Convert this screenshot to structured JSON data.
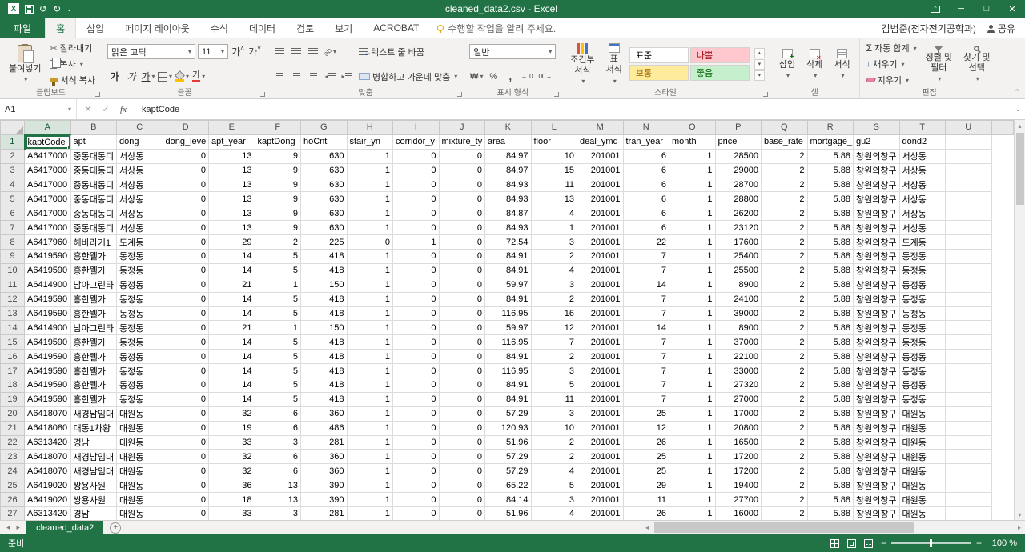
{
  "window": {
    "title": "cleaned_data2.csv - Excel"
  },
  "tabs": {
    "file": "파일",
    "items": [
      "홈",
      "삽입",
      "페이지 레이아웃",
      "수식",
      "데이터",
      "검토",
      "보기",
      "ACROBAT"
    ],
    "active": "홈",
    "tell_me": "수행할 작업을 알려 주세요.",
    "account": "김범준(전자전기공학과)",
    "share": "공유"
  },
  "ribbon": {
    "clipboard": {
      "label": "클립보드",
      "paste": "붙여넣기",
      "cut": "잘라내기",
      "copy": "복사",
      "format_painter": "서식 복사"
    },
    "font": {
      "label": "글꼴",
      "family": "맑은 고딕",
      "size": "11"
    },
    "alignment": {
      "label": "맞춤",
      "wrap": "텍스트 줄 바꿈",
      "merge": "병합하고 가운데 맞춤"
    },
    "number": {
      "label": "표시 형식",
      "format": "일반"
    },
    "styles": {
      "label": "스타일",
      "conditional_line1": "조건부",
      "conditional_line2": "서식",
      "table_line1": "표",
      "table_line2": "서식",
      "cell_styles": [
        "표준",
        "나쁨",
        "보통",
        "좋음"
      ]
    },
    "cells": {
      "label": "셀",
      "insert": "삽입",
      "delete": "삭제",
      "format": "서식"
    },
    "editing": {
      "label": "편집",
      "autosum": "자동 합계",
      "fill": "채우기",
      "clear": "지우기",
      "sort_line1": "정렬 및",
      "sort_line2": "필터",
      "find_line1": "찾기 및",
      "find_line2": "선택"
    }
  },
  "formula_bar": {
    "name_box": "A1",
    "content": "kaptCode"
  },
  "grid": {
    "selected_cell": "A1",
    "selected_col": "A",
    "selected_row": 1,
    "columns": [
      "A",
      "B",
      "C",
      "D",
      "E",
      "F",
      "G",
      "H",
      "I",
      "J",
      "K",
      "L",
      "M",
      "N",
      "O",
      "P",
      "Q",
      "R",
      "S",
      "T",
      "U"
    ],
    "col_headers": [
      "kaptCode",
      "apt",
      "dong",
      "dong_leve",
      "apt_year",
      "kaptDong",
      "hoCnt",
      "stair_yn",
      "corridor_y",
      "mixture_ty",
      "area",
      "floor",
      "deal_ymd",
      "tran_year",
      "month",
      "price",
      "base_rate",
      "mortgage_",
      "gu2",
      "dond2"
    ],
    "numeric_columns": [
      3,
      4,
      5,
      6,
      7,
      8,
      9,
      10,
      11,
      12,
      13,
      14,
      15,
      16,
      17
    ],
    "rows": [
      [
        "A6417000",
        "중동대동디",
        "서상동",
        "0",
        "13",
        "9",
        "630",
        "1",
        "0",
        "0",
        "84.97",
        "10",
        "201001",
        "6",
        "1",
        "28500",
        "2",
        "5.88",
        "창원의창구",
        "서상동"
      ],
      [
        "A6417000",
        "중동대동디",
        "서상동",
        "0",
        "13",
        "9",
        "630",
        "1",
        "0",
        "0",
        "84.97",
        "15",
        "201001",
        "6",
        "1",
        "29000",
        "2",
        "5.88",
        "창원의창구",
        "서상동"
      ],
      [
        "A6417000",
        "중동대동디",
        "서상동",
        "0",
        "13",
        "9",
        "630",
        "1",
        "0",
        "0",
        "84.93",
        "11",
        "201001",
        "6",
        "1",
        "28700",
        "2",
        "5.88",
        "창원의창구",
        "서상동"
      ],
      [
        "A6417000",
        "중동대동디",
        "서상동",
        "0",
        "13",
        "9",
        "630",
        "1",
        "0",
        "0",
        "84.93",
        "13",
        "201001",
        "6",
        "1",
        "28800",
        "2",
        "5.88",
        "창원의창구",
        "서상동"
      ],
      [
        "A6417000",
        "중동대동디",
        "서상동",
        "0",
        "13",
        "9",
        "630",
        "1",
        "0",
        "0",
        "84.87",
        "4",
        "201001",
        "6",
        "1",
        "26200",
        "2",
        "5.88",
        "창원의창구",
        "서상동"
      ],
      [
        "A6417000",
        "중동대동디",
        "서상동",
        "0",
        "13",
        "9",
        "630",
        "1",
        "0",
        "0",
        "84.93",
        "1",
        "201001",
        "6",
        "1",
        "23120",
        "2",
        "5.88",
        "창원의창구",
        "서상동"
      ],
      [
        "A6417960",
        "해바라기1",
        "도계동",
        "0",
        "29",
        "2",
        "225",
        "0",
        "1",
        "0",
        "72.54",
        "3",
        "201001",
        "22",
        "1",
        "17600",
        "2",
        "5.88",
        "창원의창구",
        "도계동"
      ],
      [
        "A6419590",
        "흥한웰가",
        "동정동",
        "0",
        "14",
        "5",
        "418",
        "1",
        "0",
        "0",
        "84.91",
        "2",
        "201001",
        "7",
        "1",
        "25400",
        "2",
        "5.88",
        "창원의창구",
        "동정동"
      ],
      [
        "A6419590",
        "흥한웰가",
        "동정동",
        "0",
        "14",
        "5",
        "418",
        "1",
        "0",
        "0",
        "84.91",
        "4",
        "201001",
        "7",
        "1",
        "25500",
        "2",
        "5.88",
        "창원의창구",
        "동정동"
      ],
      [
        "A6414900",
        "남아그린타",
        "동정동",
        "0",
        "21",
        "1",
        "150",
        "1",
        "0",
        "0",
        "59.97",
        "3",
        "201001",
        "14",
        "1",
        "8900",
        "2",
        "5.88",
        "창원의창구",
        "동정동"
      ],
      [
        "A6419590",
        "흥한웰가",
        "동정동",
        "0",
        "14",
        "5",
        "418",
        "1",
        "0",
        "0",
        "84.91",
        "2",
        "201001",
        "7",
        "1",
        "24100",
        "2",
        "5.88",
        "창원의창구",
        "동정동"
      ],
      [
        "A6419590",
        "흥한웰가",
        "동정동",
        "0",
        "14",
        "5",
        "418",
        "1",
        "0",
        "0",
        "116.95",
        "16",
        "201001",
        "7",
        "1",
        "39000",
        "2",
        "5.88",
        "창원의창구",
        "동정동"
      ],
      [
        "A6414900",
        "남아그린타",
        "동정동",
        "0",
        "21",
        "1",
        "150",
        "1",
        "0",
        "0",
        "59.97",
        "12",
        "201001",
        "14",
        "1",
        "8900",
        "2",
        "5.88",
        "창원의창구",
        "동정동"
      ],
      [
        "A6419590",
        "흥한웰가",
        "동정동",
        "0",
        "14",
        "5",
        "418",
        "1",
        "0",
        "0",
        "116.95",
        "7",
        "201001",
        "7",
        "1",
        "37000",
        "2",
        "5.88",
        "창원의창구",
        "동정동"
      ],
      [
        "A6419590",
        "흥한웰가",
        "동정동",
        "0",
        "14",
        "5",
        "418",
        "1",
        "0",
        "0",
        "84.91",
        "2",
        "201001",
        "7",
        "1",
        "22100",
        "2",
        "5.88",
        "창원의창구",
        "동정동"
      ],
      [
        "A6419590",
        "흥한웰가",
        "동정동",
        "0",
        "14",
        "5",
        "418",
        "1",
        "0",
        "0",
        "116.95",
        "3",
        "201001",
        "7",
        "1",
        "33000",
        "2",
        "5.88",
        "창원의창구",
        "동정동"
      ],
      [
        "A6419590",
        "흥한웰가",
        "동정동",
        "0",
        "14",
        "5",
        "418",
        "1",
        "0",
        "0",
        "84.91",
        "5",
        "201001",
        "7",
        "1",
        "27320",
        "2",
        "5.88",
        "창원의창구",
        "동정동"
      ],
      [
        "A6419590",
        "흥한웰가",
        "동정동",
        "0",
        "14",
        "5",
        "418",
        "1",
        "0",
        "0",
        "84.91",
        "11",
        "201001",
        "7",
        "1",
        "27000",
        "2",
        "5.88",
        "창원의창구",
        "동정동"
      ],
      [
        "A6418070",
        "새경남임대",
        "대원동",
        "0",
        "32",
        "6",
        "360",
        "1",
        "0",
        "0",
        "57.29",
        "3",
        "201001",
        "25",
        "1",
        "17000",
        "2",
        "5.88",
        "창원의창구",
        "대원동"
      ],
      [
        "A6418080",
        "대동1차황",
        "대원동",
        "0",
        "19",
        "6",
        "486",
        "1",
        "0",
        "0",
        "120.93",
        "10",
        "201001",
        "12",
        "1",
        "20800",
        "2",
        "5.88",
        "창원의창구",
        "대원동"
      ],
      [
        "A6313420",
        "경남",
        "대원동",
        "0",
        "33",
        "3",
        "281",
        "1",
        "0",
        "0",
        "51.96",
        "2",
        "201001",
        "26",
        "1",
        "16500",
        "2",
        "5.88",
        "창원의창구",
        "대원동"
      ],
      [
        "A6418070",
        "새경남임대",
        "대원동",
        "0",
        "32",
        "6",
        "360",
        "1",
        "0",
        "0",
        "57.29",
        "2",
        "201001",
        "25",
        "1",
        "17200",
        "2",
        "5.88",
        "창원의창구",
        "대원동"
      ],
      [
        "A6418070",
        "새경남임대",
        "대원동",
        "0",
        "32",
        "6",
        "360",
        "1",
        "0",
        "0",
        "57.29",
        "4",
        "201001",
        "25",
        "1",
        "17200",
        "2",
        "5.88",
        "창원의창구",
        "대원동"
      ],
      [
        "A6419020",
        "쌍용사원",
        "대원동",
        "0",
        "36",
        "13",
        "390",
        "1",
        "0",
        "0",
        "65.22",
        "5",
        "201001",
        "29",
        "1",
        "19400",
        "2",
        "5.88",
        "창원의창구",
        "대원동"
      ],
      [
        "A6419020",
        "쌍용사원",
        "대원동",
        "0",
        "18",
        "13",
        "390",
        "1",
        "0",
        "0",
        "84.14",
        "3",
        "201001",
        "11",
        "1",
        "27700",
        "2",
        "5.88",
        "창원의창구",
        "대원동"
      ],
      [
        "A6313420",
        "경남",
        "대원동",
        "0",
        "33",
        "3",
        "281",
        "1",
        "0",
        "0",
        "51.96",
        "4",
        "201001",
        "26",
        "1",
        "16000",
        "2",
        "5.88",
        "창원의창구",
        "대원동"
      ]
    ]
  },
  "sheet_tabs": {
    "active": "cleaned_data2"
  },
  "status_bar": {
    "ready": "준비",
    "zoom": "100 %"
  },
  "colors": {
    "accent": "#217346",
    "bad_bg": "#ffc7ce",
    "neutral_bg": "#ffeb9c",
    "good_bg": "#c6efce"
  }
}
